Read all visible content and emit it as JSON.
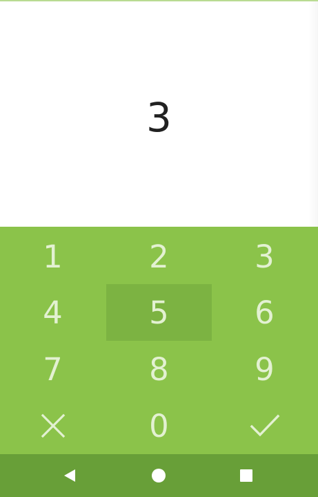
{
  "display": {
    "value": "3"
  },
  "keypad": {
    "keys": [
      {
        "label": "1",
        "name": "key-1"
      },
      {
        "label": "2",
        "name": "key-2"
      },
      {
        "label": "3",
        "name": "key-3"
      },
      {
        "label": "4",
        "name": "key-4"
      },
      {
        "label": "5",
        "name": "key-5"
      },
      {
        "label": "6",
        "name": "key-6"
      },
      {
        "label": "7",
        "name": "key-7"
      },
      {
        "label": "8",
        "name": "key-8"
      },
      {
        "label": "9",
        "name": "key-9"
      },
      {
        "label": "0",
        "name": "key-0"
      }
    ],
    "cancel_icon": "close-icon",
    "confirm_icon": "check-icon",
    "pressed_key": "5"
  },
  "navbar": {
    "back_icon": "back-triangle-icon",
    "home_icon": "home-circle-icon",
    "recents_icon": "recents-square-icon"
  },
  "colors": {
    "keypad_bg": "#8bc34a",
    "key_pressed_bg": "#7cb342",
    "key_text": "#e3f1d2",
    "navbar_bg": "#689f38",
    "display_text": "#212121"
  }
}
